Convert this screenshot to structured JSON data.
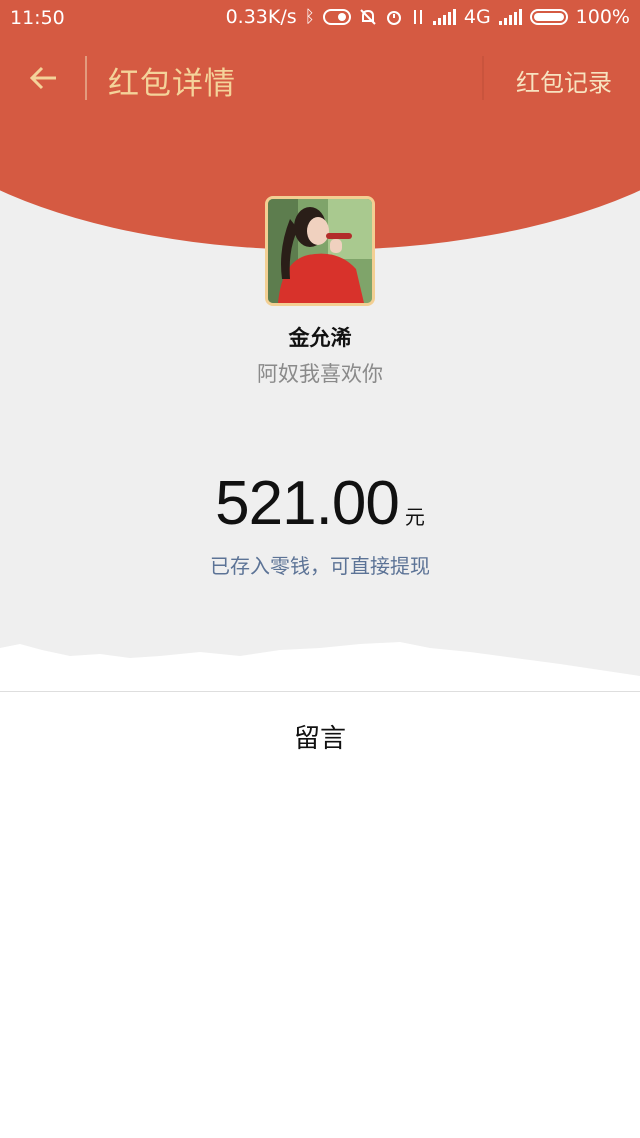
{
  "status_bar": {
    "time": "11:50",
    "speed": "0.33K/s",
    "network": "4G",
    "battery": "100%"
  },
  "toolbar": {
    "back_icon": "arrow-left-icon",
    "title": "红包详情",
    "records_label": "红包记录"
  },
  "sender": {
    "name": "金允浠",
    "greeting": "阿奴我喜欢你"
  },
  "packet": {
    "amount": "521.00",
    "unit": "元",
    "deposit_note": "已存入零钱，可直接提现"
  },
  "message": {
    "label": "留言"
  },
  "colors": {
    "header_red": "#d55a42",
    "gold_text": "#f4d39a",
    "link_blue": "#5c7396",
    "content_gray": "#efefef"
  }
}
